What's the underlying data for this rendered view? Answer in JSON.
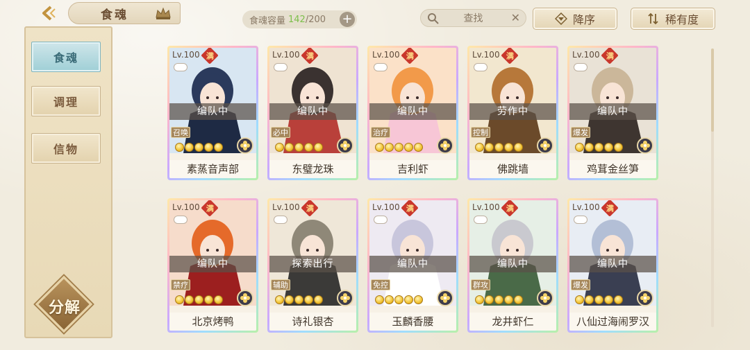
{
  "header": {
    "title": "食魂",
    "capacity_label": "食魂容量",
    "capacity_current": "142",
    "capacity_total": "/200",
    "add_symbol": "+",
    "search_placeholder": "查找",
    "sort_desc_label": "降序",
    "sort_rarity_label": "稀有度"
  },
  "sidebar": {
    "items": [
      {
        "label": "食魂",
        "active": true
      },
      {
        "label": "调理",
        "active": false
      },
      {
        "label": "信物",
        "active": false
      }
    ],
    "decompose_label": "分解"
  },
  "cards": [
    {
      "level": "Lv.100",
      "full": "满",
      "status": "编队中",
      "role": "召唤",
      "name": "素蒸音声部",
      "stars": 5,
      "palette": [
        "#d8e6f2",
        "#2b3a5c",
        "#1e2a44"
      ]
    },
    {
      "level": "Lv.100",
      "full": "满",
      "status": "编队中",
      "role": "必中",
      "name": "东璧龙珠",
      "stars": 5,
      "palette": [
        "#efe3d2",
        "#3a3230",
        "#b9403a"
      ]
    },
    {
      "level": "Lv.100",
      "full": "满",
      "status": "编队中",
      "role": "治疗",
      "name": "吉利虾",
      "stars": 5,
      "palette": [
        "#fbe1c8",
        "#f29a4a",
        "#f7c6d6"
      ]
    },
    {
      "level": "Lv.100",
      "full": "满",
      "status": "劳作中",
      "role": "控制",
      "name": "佛跳墙",
      "stars": 5,
      "palette": [
        "#f2e7cf",
        "#b7783a",
        "#6b4a2a"
      ]
    },
    {
      "level": "Lv.100",
      "full": "满",
      "status": "编队中",
      "role": "爆发",
      "name": "鸡茸金丝笋",
      "stars": 5,
      "palette": [
        "#e9e2d6",
        "#cbb79a",
        "#3e3530"
      ]
    },
    {
      "level": "Lv.100",
      "full": "满",
      "status": "编队中",
      "role": "禁疗",
      "name": "北京烤鸭",
      "stars": 5,
      "palette": [
        "#f6dccb",
        "#e56a2a",
        "#9c1f1f"
      ]
    },
    {
      "level": "Lv.100",
      "full": "满",
      "status": "探索出行",
      "role": "辅助",
      "name": "诗礼银杏",
      "stars": 5,
      "palette": [
        "#efe7d8",
        "#8f8878",
        "#3b3a38"
      ]
    },
    {
      "level": "Lv.100",
      "full": "满",
      "status": "编队中",
      "role": "免控",
      "name": "玉麟香腰",
      "stars": 5,
      "palette": [
        "#eeeaf2",
        "#c8c6dc",
        "#ffffff"
      ]
    },
    {
      "level": "Lv.100",
      "full": "满",
      "status": "编队中",
      "role": "群攻",
      "name": "龙井虾仁",
      "stars": 5,
      "palette": [
        "#e6efe6",
        "#c9c9cf",
        "#4a6a48"
      ]
    },
    {
      "level": "Lv.100",
      "full": "满",
      "status": "编队中",
      "role": "爆发",
      "name": "八仙过海闹罗汉",
      "stars": 5,
      "palette": [
        "#e8edf4",
        "#b3bfd6",
        "#3a3f52"
      ]
    }
  ]
}
